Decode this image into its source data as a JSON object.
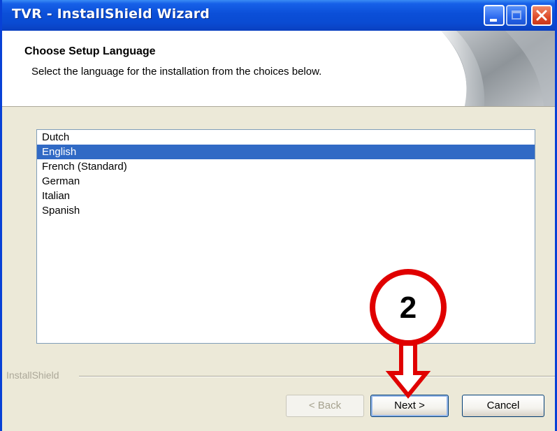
{
  "window": {
    "title": "TVR - InstallShield Wizard",
    "controls": [
      "minimize",
      "maximize",
      "close"
    ]
  },
  "header": {
    "title": "Choose Setup Language",
    "subtitle": "Select the language for the installation from the choices below."
  },
  "languages": {
    "items": [
      "Dutch",
      "English",
      "French (Standard)",
      "German",
      "Italian",
      "Spanish"
    ],
    "selected": "English"
  },
  "footer": {
    "brand": "InstallShield",
    "back_label": "< Back",
    "back_enabled": false,
    "next_label": "Next >",
    "cancel_label": "Cancel"
  },
  "annotation": {
    "step_number": "2",
    "color": "#e00000"
  },
  "colors": {
    "title_bar": "#0a4bd2",
    "selection": "#316ac5",
    "dialog_face": "#ece9d8"
  }
}
